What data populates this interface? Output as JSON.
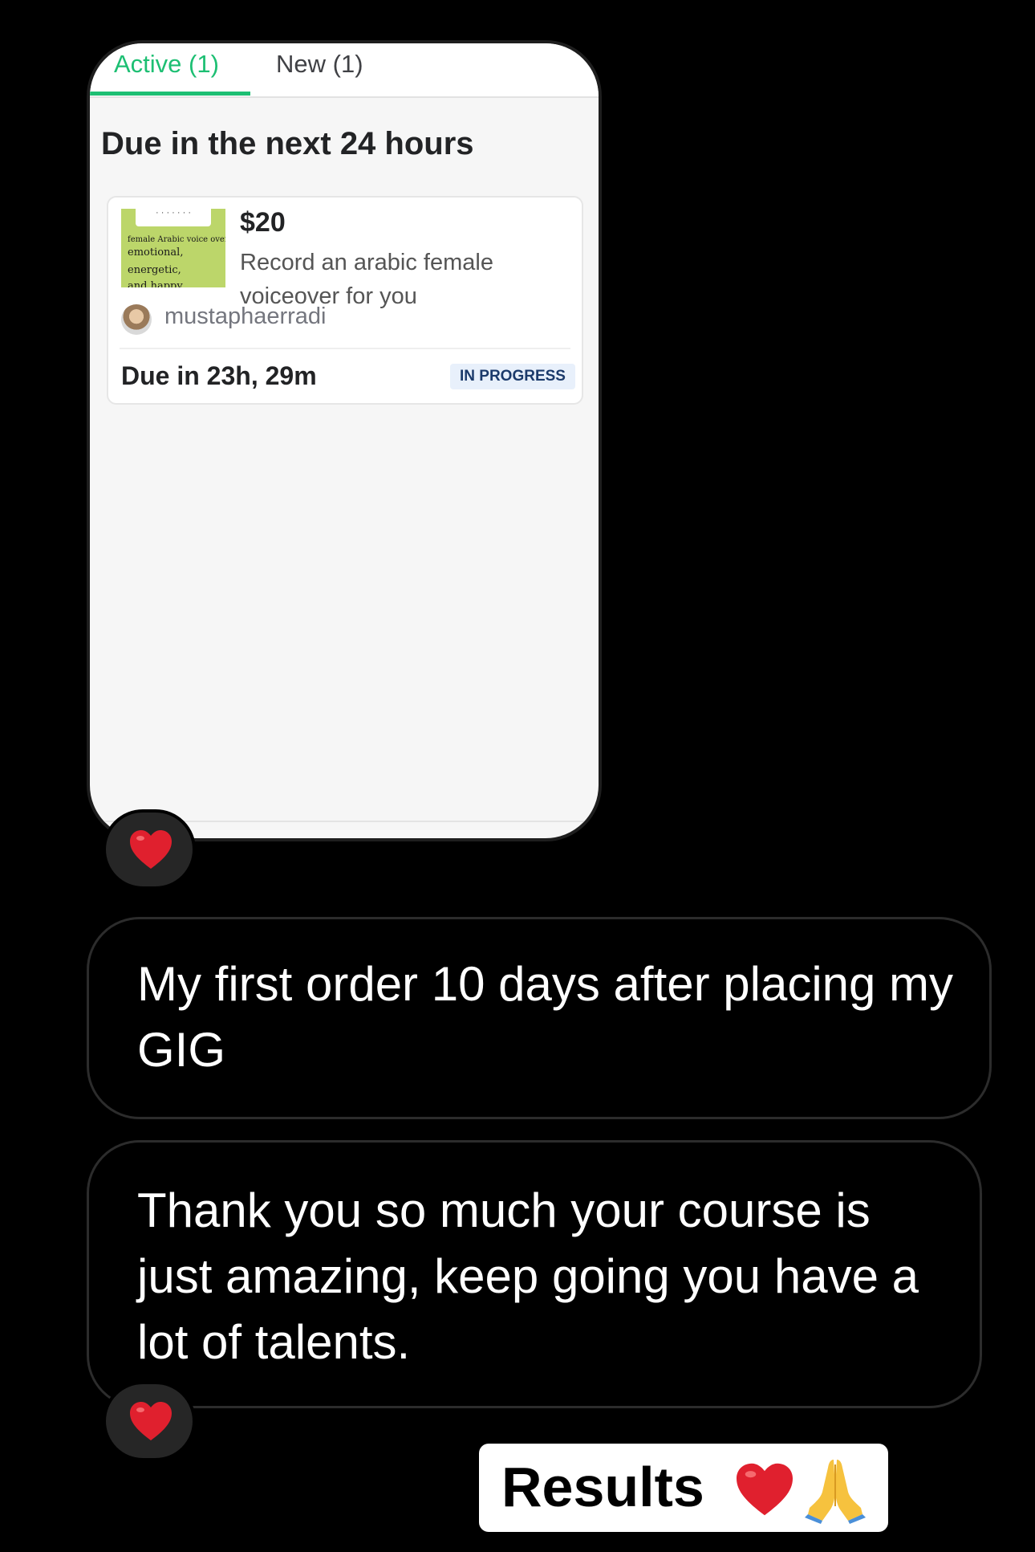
{
  "order_screen": {
    "tabs": [
      {
        "label": "Active (1)"
      },
      {
        "label": "New (1)"
      }
    ],
    "section_title": "Due in the next 24 hours",
    "order": {
      "thumbnail_text": [
        "female Arabic voice over",
        "emotional,",
        "energetic,",
        "and happy"
      ],
      "price": "$20",
      "description": "Record an arabic female voiceover for you",
      "seller": "mustaphaerradi",
      "due": "Due in 23h, 29m",
      "status": "IN PROGRESS"
    }
  },
  "messages": [
    {
      "text": "My first order 10 days after placing my GIG"
    },
    {
      "text": "Thank you so much your course is just amazing, keep going you have a lot of talents."
    }
  ],
  "reactions": [
    "heart-emoji",
    "heart-emoji"
  ],
  "results_label": "Results",
  "colors": {
    "background": "#000000",
    "accent_green": "#1dbf73",
    "heart": "#e0202e",
    "badge_bg": "#e8f0fb",
    "bubble_border": "#2c2c2c"
  }
}
